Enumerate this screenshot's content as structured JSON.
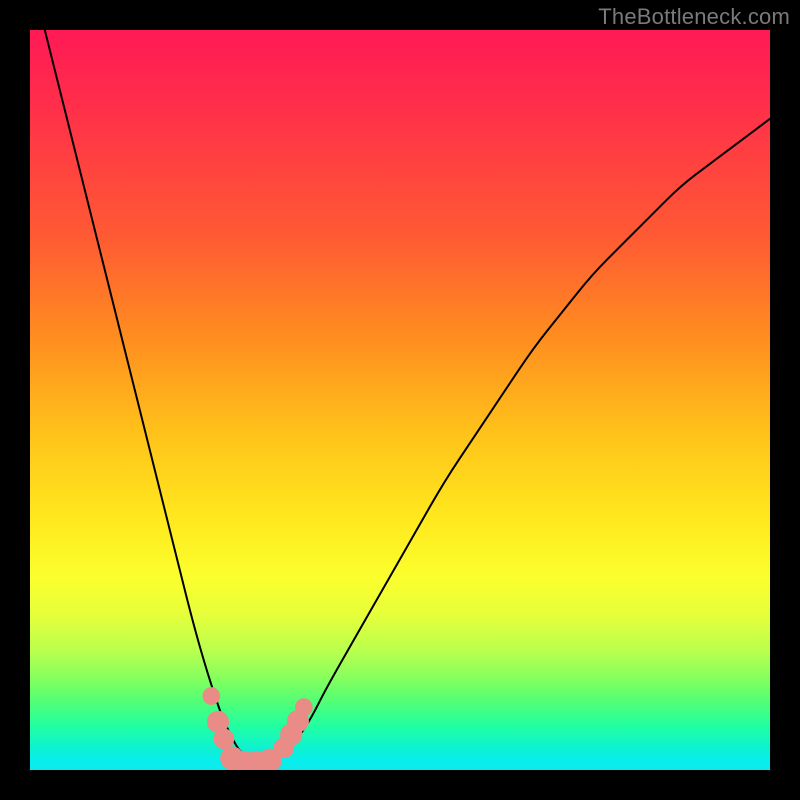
{
  "watermark": "TheBottleneck.com",
  "chart_data": {
    "type": "line",
    "title": "",
    "xlabel": "",
    "ylabel": "",
    "xlim": [
      0,
      100
    ],
    "ylim": [
      0,
      100
    ],
    "background_gradient": [
      "#ff1a55",
      "#ff8f1f",
      "#ffe81e",
      "#22ffa0",
      "#12e8ea"
    ],
    "series": [
      {
        "name": "curve",
        "color": "#000000",
        "x": [
          0,
          2,
          4,
          6,
          8,
          10,
          12,
          14,
          16,
          18,
          20,
          22,
          24,
          26,
          27,
          28,
          29,
          30,
          31,
          32,
          34,
          36,
          38,
          40,
          44,
          48,
          52,
          56,
          60,
          64,
          68,
          72,
          76,
          80,
          84,
          88,
          92,
          96,
          100
        ],
        "y": [
          108,
          100,
          92,
          84,
          76,
          68,
          60,
          52,
          44,
          36,
          28,
          20,
          13,
          7,
          5,
          3,
          2,
          1,
          1,
          1,
          2,
          4,
          7,
          11,
          18,
          25,
          32,
          39,
          45,
          51,
          57,
          62,
          67,
          71,
          75,
          79,
          82,
          85,
          88
        ]
      }
    ],
    "markers": [
      {
        "name": "left-dot-1",
        "x": 24.5,
        "y": 10.0,
        "r": 1.2,
        "color": "#e98b86"
      },
      {
        "name": "left-dot-2",
        "x": 25.4,
        "y": 6.5,
        "r": 1.5,
        "color": "#e98b86"
      },
      {
        "name": "left-dot-3",
        "x": 26.2,
        "y": 4.2,
        "r": 1.4,
        "color": "#e98b86"
      },
      {
        "name": "flat-dot-1",
        "x": 27.3,
        "y": 1.6,
        "r": 1.6,
        "color": "#e98b86"
      },
      {
        "name": "flat-dot-2",
        "x": 29.0,
        "y": 1.0,
        "r": 1.6,
        "color": "#e98b86"
      },
      {
        "name": "flat-dot-3",
        "x": 30.7,
        "y": 1.0,
        "r": 1.6,
        "color": "#e98b86"
      },
      {
        "name": "flat-dot-4",
        "x": 32.4,
        "y": 1.3,
        "r": 1.6,
        "color": "#e98b86"
      },
      {
        "name": "right-dot-1",
        "x": 34.3,
        "y": 3.0,
        "r": 1.4,
        "color": "#e98b86"
      },
      {
        "name": "right-dot-2",
        "x": 35.3,
        "y": 4.8,
        "r": 1.5,
        "color": "#e98b86"
      },
      {
        "name": "right-dot-3",
        "x": 36.2,
        "y": 6.6,
        "r": 1.5,
        "color": "#e98b86"
      },
      {
        "name": "right-dot-4",
        "x": 37.0,
        "y": 8.5,
        "r": 1.2,
        "color": "#e98b86"
      }
    ]
  }
}
